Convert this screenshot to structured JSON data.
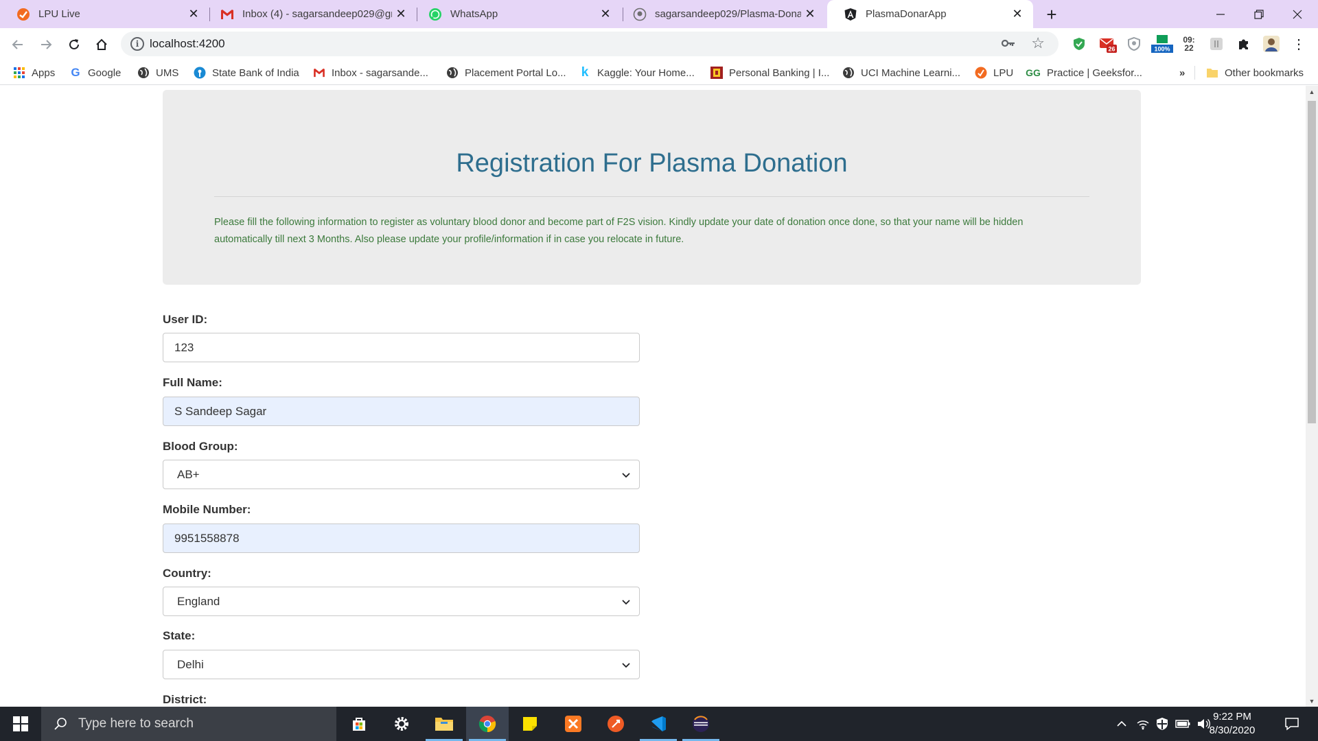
{
  "browser": {
    "tabs": [
      {
        "title": "LPU Live",
        "icon": "lpu-live-icon",
        "active": false
      },
      {
        "title": "Inbox (4) - sagarsandeep029@gm",
        "icon": "gmail-icon",
        "active": false
      },
      {
        "title": "WhatsApp",
        "icon": "whatsapp-icon",
        "active": false
      },
      {
        "title": "sagarsandeep029/Plasma-Donat",
        "icon": "github-icon",
        "active": false
      },
      {
        "title": "PlasmaDonarApp",
        "icon": "angular-icon",
        "active": true
      }
    ],
    "url": "localhost:4200",
    "extensions": {
      "gmail_badge": "26",
      "percent_badge": "100%",
      "clock_hour": "09:",
      "clock_min": "22"
    },
    "bookmarks": [
      {
        "label": "Apps",
        "icon": "apps-grid-icon"
      },
      {
        "label": "Google",
        "icon": "google-icon"
      },
      {
        "label": "UMS",
        "icon": "globe-icon"
      },
      {
        "label": "State Bank of India",
        "icon": "sbi-icon"
      },
      {
        "label": "Inbox - sagarsande...",
        "icon": "gmail-icon"
      },
      {
        "label": "Placement Portal Lo...",
        "icon": "globe-icon"
      },
      {
        "label": "Kaggle: Your Home...",
        "icon": "kaggle-icon"
      },
      {
        "label": "Personal Banking | I...",
        "icon": "pnb-icon"
      },
      {
        "label": "UCI Machine Learni...",
        "icon": "globe-icon"
      },
      {
        "label": "LPU",
        "icon": "lpu-icon"
      },
      {
        "label": "Practice | Geeksfor...",
        "icon": "geeksforgeeks-icon"
      }
    ],
    "bookmarks_overflow": "»",
    "other_bookmarks": "Other bookmarks"
  },
  "page": {
    "heading": "Registration For Plasma Donation",
    "intro_line1": "Please fill the following information to register as voluntary blood donor and become part of F2S vision. Kindly update your date of donation once done, so that your name will be hidden",
    "intro_line2": "automatically till next 3 Months. Also please update your profile/information if in case you relocate in future.",
    "form": {
      "user_id": {
        "label": "User ID:",
        "value": "123"
      },
      "full_name": {
        "label": "Full Name:",
        "value": "S Sandeep Sagar"
      },
      "blood_group": {
        "label": "Blood Group:",
        "value": "AB+"
      },
      "mobile": {
        "label": "Mobile Number:",
        "value": "9951558878"
      },
      "country": {
        "label": "Country:",
        "value": "England"
      },
      "state": {
        "label": "State:",
        "value": "Delhi"
      },
      "district": {
        "label": "District:"
      }
    }
  },
  "taskbar": {
    "search_placeholder": "Type here to search",
    "time": "9:22 PM",
    "date": "8/30/2020"
  },
  "colors": {
    "tab_strip": "#e6d6f7",
    "heading": "#2e6e8e",
    "intro_text": "#3c7a3c",
    "jumbotron": "#ececec",
    "autofill": "#e8f0fe"
  }
}
